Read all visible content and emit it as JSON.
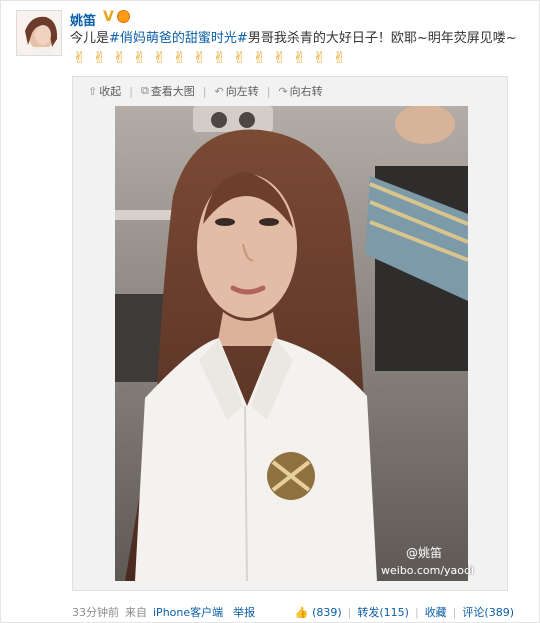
{
  "post": {
    "username": "姚笛",
    "verified_mark": "V",
    "text_prefix": "今儿是",
    "hashtag_one": "#俏妈萌爸的甜蜜时光#",
    "text_middle": "男哥我杀青的大好日子！欧耶~明年荧屏见喽~",
    "emoji_icon": "victory-hand",
    "emoji_glyph": "✌",
    "emoji_count": 14
  },
  "toolbar": {
    "collapse": "收起",
    "view_large": "查看大图",
    "rotate_left": "向左转",
    "rotate_right": "向右转"
  },
  "photo": {
    "watermark_handle": "@姚笛",
    "watermark_url": "weibo.com/yaodi"
  },
  "footer": {
    "time": "33分钟前",
    "source_prefix": "来自",
    "source": "iPhone客户端",
    "report": "举报",
    "like": "(839)",
    "repost": "转发(115)",
    "favorite": "收藏",
    "comment": "评论(389)"
  },
  "colors": {
    "link": "#0a5ea8",
    "emoji": "#e7a51e"
  }
}
